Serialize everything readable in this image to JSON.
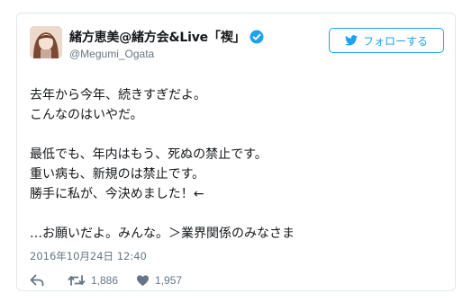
{
  "tweet": {
    "user": {
      "display_name": "緒方恵美@緒方会&Live「禊」",
      "handle": "@Megumi_Ogata",
      "verified": true,
      "avatar_icon": "user-avatar"
    },
    "follow_button": {
      "label": "フォローする",
      "icon": "twitter-bird-icon"
    },
    "text_lines": [
      "去年から今年、続きすぎだよ。",
      "こんなのはいやだ。",
      "",
      "最低でも、年内はもう、死ぬの禁止です。",
      "重い病も、新規のは禁止です。",
      "勝手に私が、今決めました！←",
      "",
      "…お願いだよ。みんな。＞業界関係のみなさま"
    ],
    "timestamp": "2016年10月24日 12:40",
    "actions": {
      "reply_icon": "reply-icon",
      "retweet_icon": "retweet-icon",
      "retweet_count": "1,886",
      "like_icon": "heart-icon",
      "like_count": "1,957"
    }
  },
  "colors": {
    "accent": "#1da1f2",
    "text": "#14171a",
    "secondary_text": "#657786",
    "border": "#e1e8ed"
  }
}
